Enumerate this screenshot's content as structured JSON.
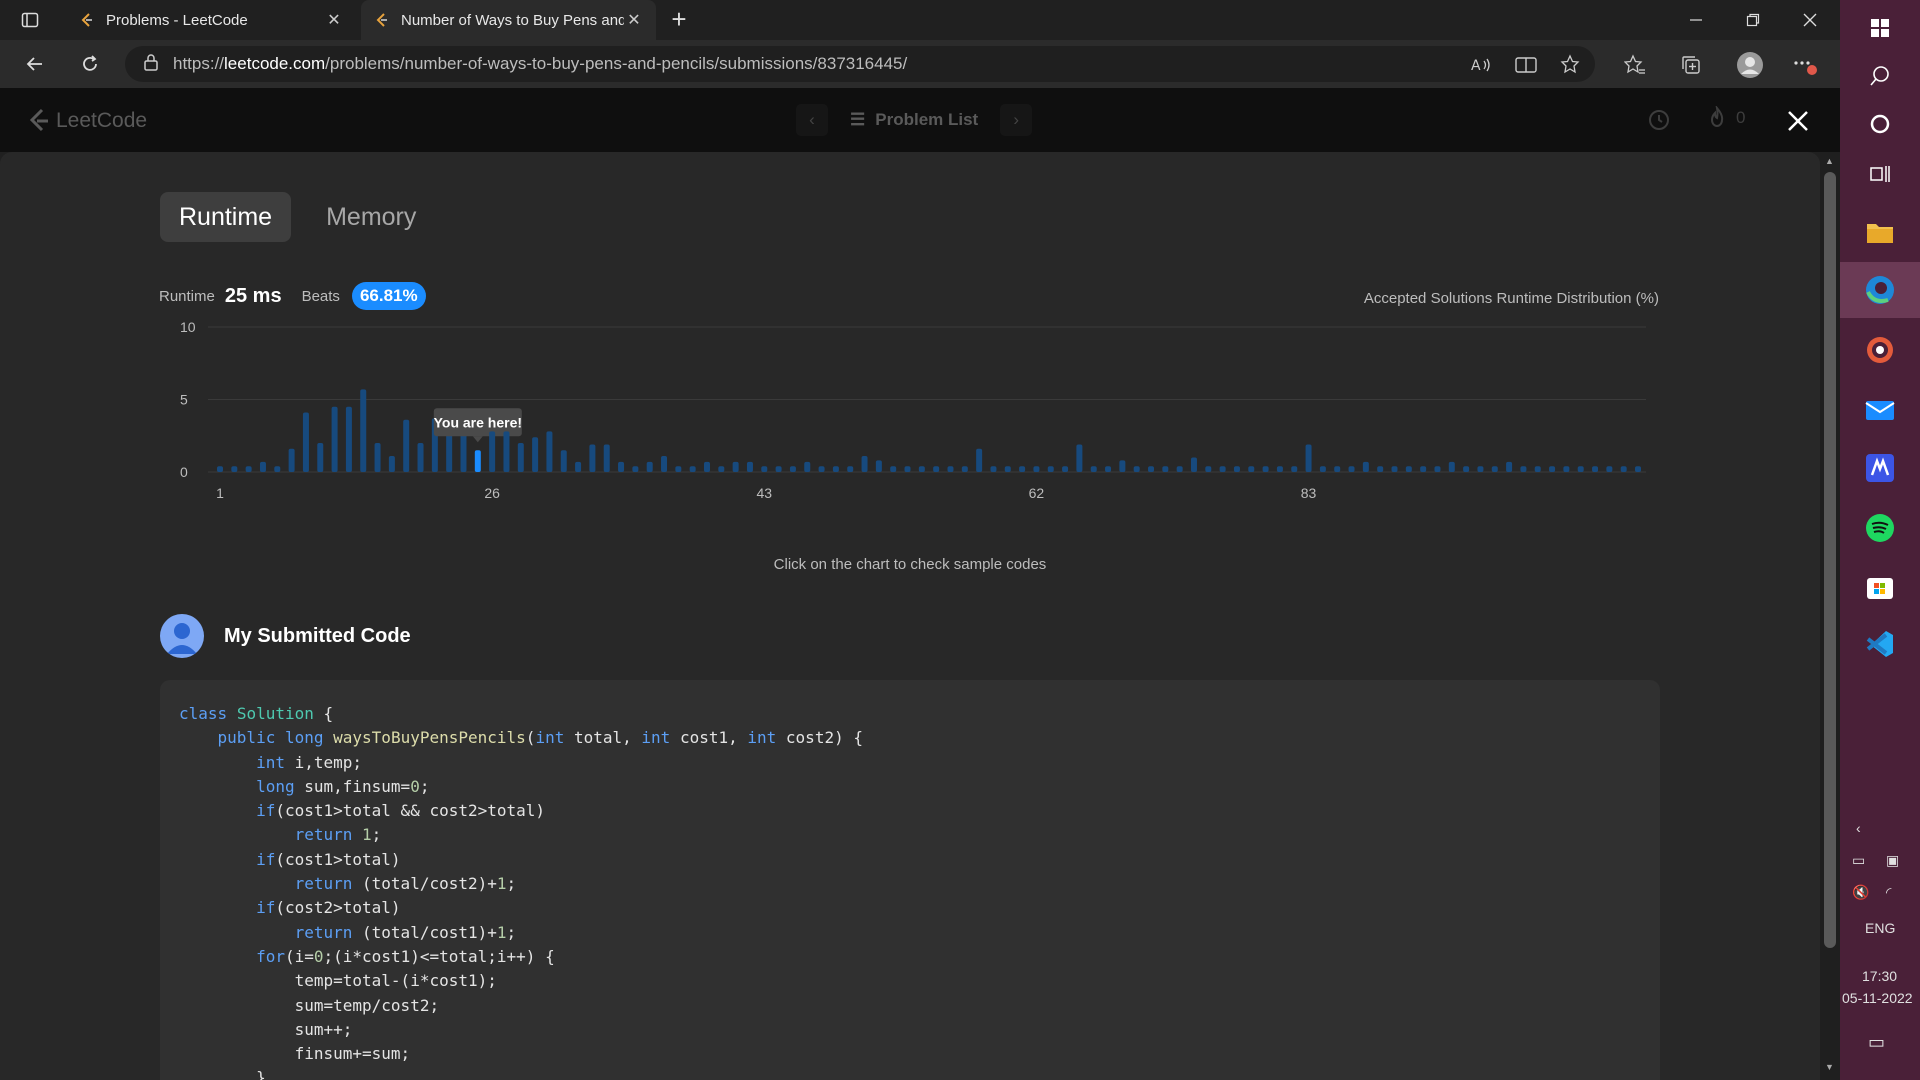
{
  "browser": {
    "tabs": [
      {
        "title": "Problems - LeetCode",
        "active": false
      },
      {
        "title": "Number of Ways to Buy Pens and Pencils",
        "active": true
      }
    ],
    "url_prefix": "https://",
    "url_host": "leetcode.com",
    "url_path": "/problems/number-of-ways-to-buy-pens-and-pencils/submissions/837316445/"
  },
  "lc_header": {
    "logo_text": "LeetCode",
    "problem_list_label": "Problem List",
    "streak_count": "0"
  },
  "result": {
    "tab_runtime": "Runtime",
    "tab_memory": "Memory",
    "runtime_label": "Runtime",
    "runtime_value": "25 ms",
    "beats_label": "Beats",
    "beats_value": "66.81%",
    "distribution_label": "Accepted Solutions Runtime Distribution (%)",
    "tooltip": "You are here!",
    "hint": "Click on the chart to check sample codes"
  },
  "chart_data": {
    "type": "bar",
    "y_ticks": [
      "0",
      "5",
      "10"
    ],
    "ylim": [
      0,
      10
    ],
    "x_tick_labels": [
      {
        "index": 0,
        "label": "1"
      },
      {
        "index": 19,
        "label": "26"
      },
      {
        "index": 38,
        "label": "43"
      },
      {
        "index": 57,
        "label": "62"
      },
      {
        "index": 76,
        "label": "83"
      }
    ],
    "highlight_index": 18,
    "values": [
      0.4,
      0.4,
      0.4,
      0.7,
      0.4,
      1.6,
      4.1,
      2.0,
      4.5,
      4.5,
      5.7,
      2.0,
      1.1,
      3.6,
      2.0,
      3.7,
      3.2,
      3.7,
      1.5,
      2.8,
      2.8,
      2.0,
      2.4,
      2.8,
      1.5,
      0.7,
      1.9,
      1.9,
      0.7,
      0.4,
      0.7,
      1.1,
      0.4,
      0.4,
      0.7,
      0.4,
      0.7,
      0.7,
      0.4,
      0.4,
      0.4,
      0.4,
      0.4,
      0.4,
      0.4,
      1.1,
      0.7,
      0.4,
      0.4,
      0.4,
      0.4,
      0.4,
      0.4,
      0.4,
      0.4,
      0.4,
      0.4,
      0.4,
      0.4,
      0.4,
      0.4,
      0.4,
      0.4,
      0.4,
      0.4,
      0.4,
      0.4,
      0.4,
      0.4,
      0.4,
      0.4,
      0.4,
      0.4,
      0.4,
      0.4,
      0.4,
      0.4,
      0.4,
      0.4,
      0.4,
      0.4,
      0.4,
      0.4,
      0.4,
      0.4,
      0.4,
      0.4,
      0.4,
      0.4,
      0.4,
      0.4,
      0.4,
      0.4,
      0.4,
      0.4,
      0.4,
      0.4,
      0.4,
      0.4,
      0.4
    ],
    "extra_peaks": {
      "53": 1.6,
      "60": 1.9,
      "76": 1.9,
      "45": 1.1,
      "46": 0.8,
      "41": 0.7,
      "63": 0.8,
      "68": 1.0,
      "80": 0.7,
      "86": 0.7,
      "90": 0.7
    },
    "bar_color": "#174a7e",
    "highlight_color": "#1a8cff"
  },
  "code": {
    "section_title": "My Submitted Code",
    "lines": [
      [
        [
          "kw",
          "class"
        ],
        [
          "t",
          " "
        ],
        [
          "cls",
          "Solution"
        ],
        [
          "t",
          " {"
        ]
      ],
      [
        [
          "t",
          "    "
        ],
        [
          "kw",
          "public"
        ],
        [
          "t",
          " "
        ],
        [
          "kw",
          "long"
        ],
        [
          "t",
          " "
        ],
        [
          "fn",
          "waysToBuyPensPencils"
        ],
        [
          "t",
          "("
        ],
        [
          "kw",
          "int"
        ],
        [
          "t",
          " total, "
        ],
        [
          "kw",
          "int"
        ],
        [
          "t",
          " cost1, "
        ],
        [
          "kw",
          "int"
        ],
        [
          "t",
          " cost2) {"
        ]
      ],
      [
        [
          "t",
          "        "
        ],
        [
          "kw",
          "int"
        ],
        [
          "t",
          " i,temp;"
        ]
      ],
      [
        [
          "t",
          "        "
        ],
        [
          "kw",
          "long"
        ],
        [
          "t",
          " sum,finsum="
        ],
        [
          "num",
          "0"
        ],
        [
          "t",
          ";"
        ]
      ],
      [
        [
          "t",
          "        "
        ],
        [
          "kw",
          "if"
        ],
        [
          "t",
          "(cost1>total && cost2>total)"
        ]
      ],
      [
        [
          "t",
          "            "
        ],
        [
          "kw",
          "return"
        ],
        [
          "t",
          " "
        ],
        [
          "num",
          "1"
        ],
        [
          "t",
          ";"
        ]
      ],
      [
        [
          "t",
          "        "
        ],
        [
          "kw",
          "if"
        ],
        [
          "t",
          "(cost1>total)"
        ]
      ],
      [
        [
          "t",
          "            "
        ],
        [
          "kw",
          "return"
        ],
        [
          "t",
          " (total/cost2)+"
        ],
        [
          "num",
          "1"
        ],
        [
          "t",
          ";"
        ]
      ],
      [
        [
          "t",
          "        "
        ],
        [
          "kw",
          "if"
        ],
        [
          "t",
          "(cost2>total)"
        ]
      ],
      [
        [
          "t",
          "            "
        ],
        [
          "kw",
          "return"
        ],
        [
          "t",
          " (total/cost1)+"
        ],
        [
          "num",
          "1"
        ],
        [
          "t",
          ";"
        ]
      ],
      [
        [
          "t",
          "        "
        ],
        [
          "kw",
          "for"
        ],
        [
          "t",
          "(i="
        ],
        [
          "num",
          "0"
        ],
        [
          "t",
          ";(i*cost1)<=total;i++) {"
        ]
      ],
      [
        [
          "t",
          "            temp=total-(i*cost1);"
        ]
      ],
      [
        [
          "t",
          "            sum=temp/cost2;"
        ]
      ],
      [
        [
          "t",
          "            sum++;"
        ]
      ],
      [
        [
          "t",
          "            finsum+=sum;"
        ]
      ],
      [
        [
          "t",
          "        }"
        ]
      ]
    ]
  },
  "taskbar": {
    "lang": "ENG",
    "time": "17:30",
    "date": "05-11-2022"
  }
}
